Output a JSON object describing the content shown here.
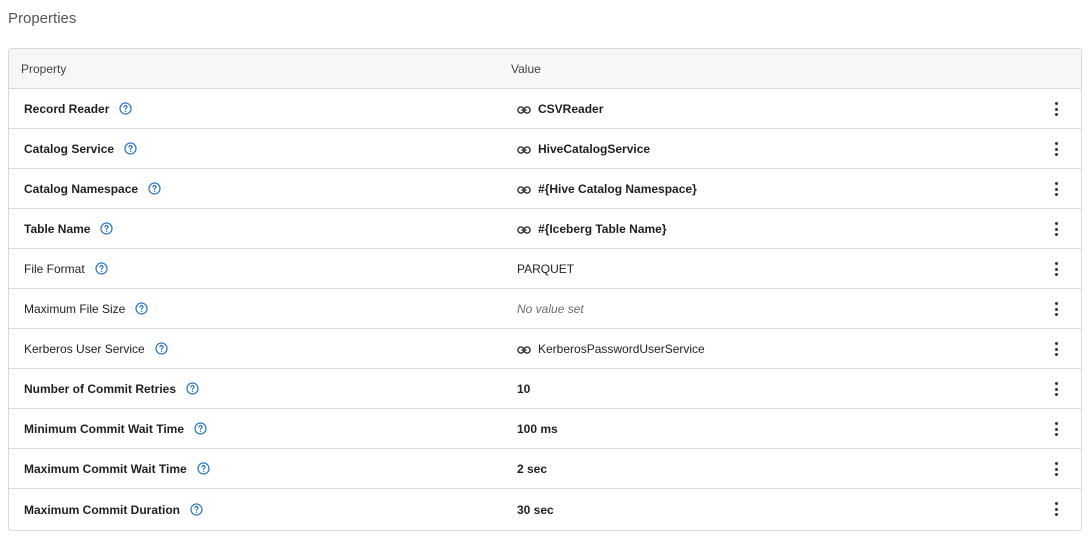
{
  "section": {
    "title": "Properties"
  },
  "table": {
    "headers": {
      "property": "Property",
      "value": "Value"
    },
    "rows": [
      {
        "name": "Record Reader",
        "value": "CSVReader",
        "bold": true,
        "link": true,
        "empty": false
      },
      {
        "name": "Catalog Service",
        "value": "HiveCatalogService",
        "bold": true,
        "link": true,
        "empty": false
      },
      {
        "name": "Catalog Namespace",
        "value": "#{Hive Catalog Namespace}",
        "bold": true,
        "link": true,
        "empty": false
      },
      {
        "name": "Table Name",
        "value": "#{Iceberg Table Name}",
        "bold": true,
        "link": true,
        "empty": false
      },
      {
        "name": "File Format",
        "value": "PARQUET",
        "bold": false,
        "link": false,
        "empty": false
      },
      {
        "name": "Maximum File Size",
        "value": "No value set",
        "bold": false,
        "link": false,
        "empty": true
      },
      {
        "name": "Kerberos User Service",
        "value": "KerberosPasswordUserService",
        "bold": false,
        "link": true,
        "empty": false
      },
      {
        "name": "Number of Commit Retries",
        "value": "10",
        "bold": true,
        "link": false,
        "empty": false
      },
      {
        "name": "Minimum Commit Wait Time",
        "value": "100 ms",
        "bold": true,
        "link": false,
        "empty": false
      },
      {
        "name": "Maximum Commit Wait Time",
        "value": "2 sec",
        "bold": true,
        "link": false,
        "empty": false
      },
      {
        "name": "Maximum Commit Duration",
        "value": "30 sec",
        "bold": true,
        "link": false,
        "empty": false
      }
    ]
  },
  "icons": {
    "help": "help-circle-icon",
    "link": "link-icon",
    "menu": "kebab-menu-icon"
  },
  "colors": {
    "help_icon": "#1a6fc4",
    "header_bg": "#f7f7f8",
    "border": "#d9d9d9"
  }
}
